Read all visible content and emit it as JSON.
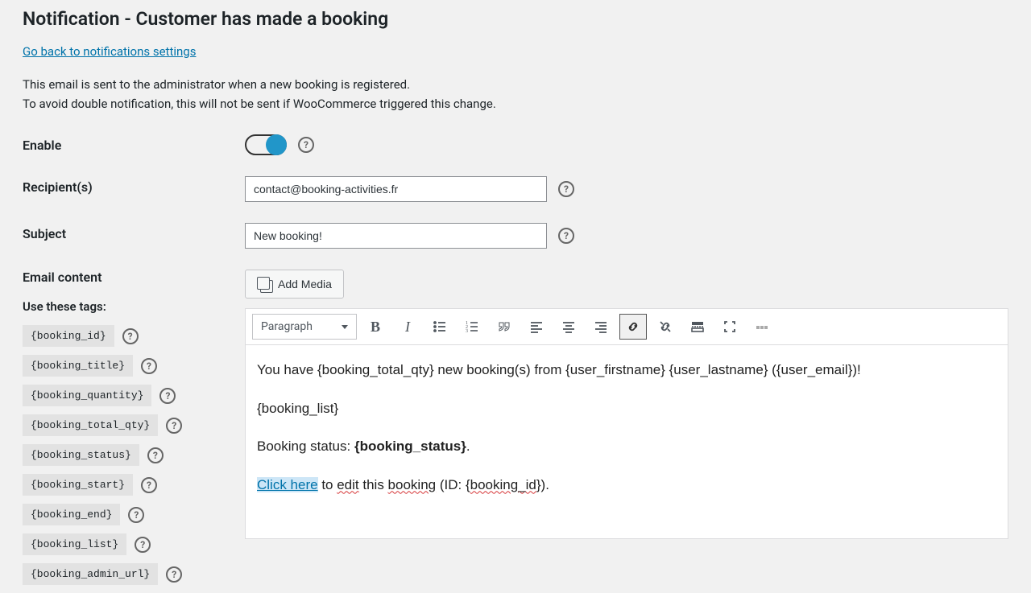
{
  "page_title": "Notification - Customer has made a booking",
  "back_link": "Go back to notifications settings",
  "description_line1": "This email is sent to the administrator when a new booking is registered.",
  "description_line2": "To avoid double notification, this will not be sent if WooCommerce triggered this change.",
  "labels": {
    "enable": "Enable",
    "recipients": "Recipient(s)",
    "subject": "Subject",
    "email_content": "Email content",
    "use_tags": "Use these tags:"
  },
  "values": {
    "recipients": "contact@booking-activities.fr",
    "subject": "New booking!"
  },
  "add_media": "Add Media",
  "format_dropdown": "Paragraph",
  "tags": [
    "{booking_id}",
    "{booking_title}",
    "{booking_quantity}",
    "{booking_total_qty}",
    "{booking_status}",
    "{booking_start}",
    "{booking_end}",
    "{booking_list}",
    "{booking_admin_url}"
  ],
  "body": {
    "line1": "You have {booking_total_qty} new booking(s) from {user_firstname} {user_lastname} ({user_email})!",
    "line2": "{booking_list}",
    "line3_pre": "Booking status: ",
    "line3_bold": "{booking_status}",
    "line3_post": ".",
    "line4_link": "Click here",
    "line4_rest_1": " to ",
    "line4_rest_2": "edit",
    "line4_rest_3": " this ",
    "line4_rest_4": "booking",
    "line4_rest_5": " (ID: {",
    "line4_rest_6": "booking_id",
    "line4_rest_7": "})."
  }
}
